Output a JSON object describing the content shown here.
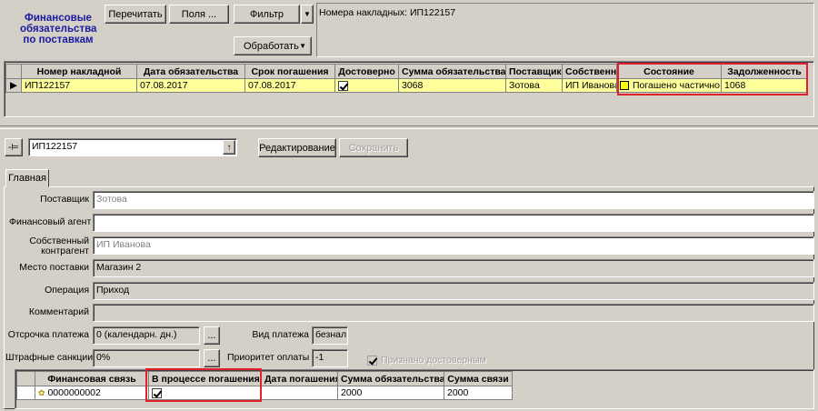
{
  "header": {
    "title": "Финансовые обязательства по поставкам",
    "btn_recalc": "Перечитать",
    "btn_fields": "Поля ...",
    "btn_filter": "Фильтр",
    "btn_process": "Обработать",
    "filter_text": "Номера накладных: ИП122157"
  },
  "top_grid": {
    "columns": [
      "Номер накладной",
      "Дата обязательства",
      "Срок погашения",
      "Достоверно",
      "Сумма обязательства",
      "Поставщик",
      "Собственн",
      "Состояние",
      "Задолженность"
    ],
    "row": {
      "invoice": "ИП122157",
      "obligation_date": "07.08.2017",
      "due_date": "07.08.2017",
      "reliable": true,
      "amount": "3068",
      "supplier": "Зотова",
      "owner": "ИП Иванова",
      "state": "Погашено частично",
      "debt": "1068",
      "state_color": "#ffff00"
    }
  },
  "detail": {
    "record_value": "ИП122157",
    "btn_edit": "Редактирование",
    "btn_save": "Сохранить",
    "tab_main": "Главная",
    "supplier_label": "Поставщик",
    "supplier_value": "Зотова",
    "agent_label": "Финансовый агент",
    "agent_value": "",
    "owner_label_1": "Собственный",
    "owner_label_2": "контрагент",
    "owner_value": "ИП Иванова",
    "place_label": "Место поставки",
    "place_value": "Магазин 2",
    "operation_label": "Операция",
    "operation_value": "Приход",
    "comment_label": "Комментарий",
    "comment_value": "",
    "delay_label": "Отсрочка платежа",
    "delay_value": "0 (календарн. дн.)",
    "paytype_label": "Вид платежа",
    "paytype_value": "безнал.",
    "penalty_label": "Штрафные санкции",
    "penalty_value": "0%",
    "priority_label": "Приоритет оплаты",
    "priority_value": "-1",
    "recognized_label": "Признано достоверным",
    "ellipsis": "..."
  },
  "bottom_grid": {
    "columns": [
      "Финансовая связь",
      "В процессе погашения",
      "Дата погашения",
      "Сумма обязательства",
      "Сумма связи"
    ],
    "row": {
      "link": "0000000002",
      "in_progress": true,
      "pay_date": "",
      "obligation_amount": "2000",
      "link_amount": "2000"
    }
  }
}
